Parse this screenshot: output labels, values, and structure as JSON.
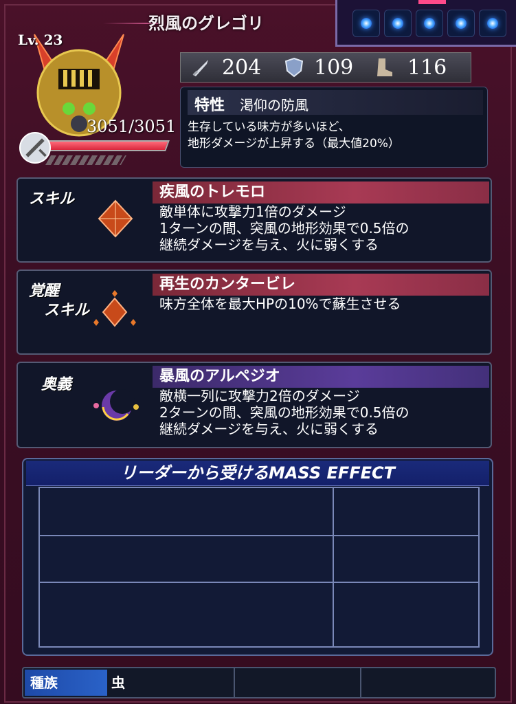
{
  "header": {
    "title": "烈風のグレゴリ"
  },
  "unit": {
    "level": "Lv. 23",
    "hp": "3051/3051",
    "hp_fraction": 1.0
  },
  "stats": {
    "attack": "204",
    "defense": "109",
    "speed": "116"
  },
  "trait": {
    "tag": "特性",
    "name": "渇仰の防風",
    "description": "生存している味方が多いほど、\n地形ダメージが上昇する（最大値20%）"
  },
  "skill": {
    "label": "スキル",
    "name": "疾風のトレモロ",
    "description": "敵単体に攻撃力1倍のダメージ\n1ターンの間、突風の地形効果で0.5倍の\n継続ダメージを与え、火に弱くする"
  },
  "awakening": {
    "label": "覚醒\n　スキル",
    "name": "再生のカンタービレ",
    "description": "味方全体を最大HPの10%で蘇生させる"
  },
  "ougi": {
    "label": "奥義",
    "name": "暴風のアルペジオ",
    "description": "敵横一列に攻撃力2倍のダメージ\n2ターンの間、突風の地形効果で0.5倍の\n継続ダメージを与え、火に弱くする"
  },
  "mass_effect": {
    "title": "リーダーから受けるMASS EFFECT"
  },
  "race": {
    "label": "種族",
    "value": "虫"
  },
  "orbs": {
    "count": 5,
    "active_index": 2
  },
  "colors": {
    "skill_band": "#a83a54",
    "ougi_band": "#5a3c9a",
    "race_label": "#2a62c8"
  }
}
